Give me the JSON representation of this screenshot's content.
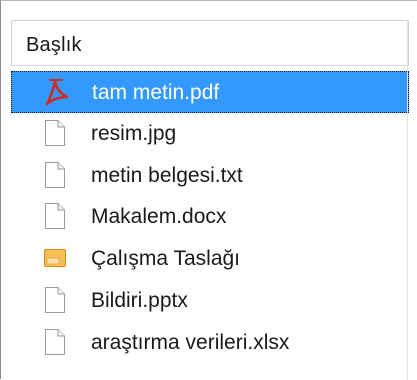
{
  "header": {
    "title": "Başlık"
  },
  "files": [
    {
      "name": "tam metin.pdf",
      "icon": "pdf-icon",
      "selected": true
    },
    {
      "name": "resim.jpg",
      "icon": "file-icon",
      "selected": false
    },
    {
      "name": "metin belgesi.txt",
      "icon": "file-icon",
      "selected": false
    },
    {
      "name": "Makalem.docx",
      "icon": "file-icon",
      "selected": false
    },
    {
      "name": "Çalışma Taslağı",
      "icon": "draft-icon",
      "selected": false
    },
    {
      "name": "Bildiri.pptx",
      "icon": "file-icon",
      "selected": false
    },
    {
      "name": "araştırma verileri.xlsx",
      "icon": "file-icon",
      "selected": false
    }
  ],
  "colors": {
    "selection": "#3399ff",
    "pdf_red": "#d22a1e",
    "draft_orange": "#f0a22c"
  }
}
